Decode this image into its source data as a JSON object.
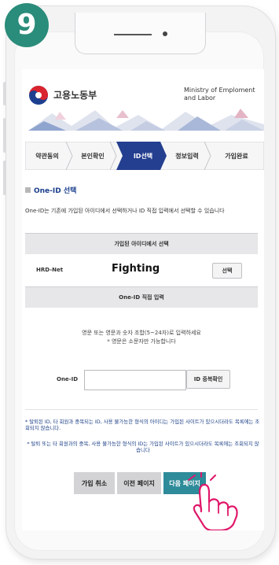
{
  "step_badge": "9",
  "header": {
    "ministry_ko": "고용노동부",
    "ministry_en": "Ministry of Emploment\nand Labor"
  },
  "steps": [
    {
      "label": "약관동의",
      "active": false
    },
    {
      "label": "본인확인",
      "active": false
    },
    {
      "label": "ID선택",
      "active": true
    },
    {
      "label": "정보입력",
      "active": false
    },
    {
      "label": "가입완료",
      "active": false
    }
  ],
  "section": {
    "title": "One-ID 선택",
    "description": "One-ID는 기존에 가입된 아이디에서 선택하거나 ID 직접 입력에서 선택할 수 있습니다"
  },
  "joined": {
    "header": "가입된 아이디에서 선택",
    "site_label": "HRD-Net",
    "user_id": "Fighting",
    "select_button": "선택"
  },
  "direct": {
    "header": "One-ID 직접 입력",
    "hint_line1": "영문 또는 영문과 숫자 조합(5~24자)로 입력하세요",
    "hint_line2": "* 영문은 소문자만 가능합니다",
    "id_label": "One-ID",
    "id_value": "",
    "check_button": "ID 중복확인"
  },
  "notes": {
    "note1": "* 탈퇴된 ID, 타 회원과 중복되는 ID, 사용 불가능한 형식의 아이디는 가입된 사이트가 있으시더라도 목록에는 조회되지 않습니다.",
    "note2": "* 탈퇴 또는 타 회원과의 중복, 사용 불가능한 형식의 ID는 가입된 사이트가 있으시더라도 목록에는 조회되지 않습니다"
  },
  "buttons": {
    "cancel": "가입 취소",
    "prev": "이전 페이지",
    "next": "다음 페이지"
  },
  "colors": {
    "badge": "#2a8c7a",
    "active_step": "#243f8f",
    "next_button": "#2e8b99",
    "gray_button": "#d3d3d6",
    "note_text": "#1b3f86",
    "hand": "#e0176a"
  },
  "icons": {
    "logo": "ministry-taegeuk-logo",
    "pointer": "pointing-hand-icon"
  }
}
